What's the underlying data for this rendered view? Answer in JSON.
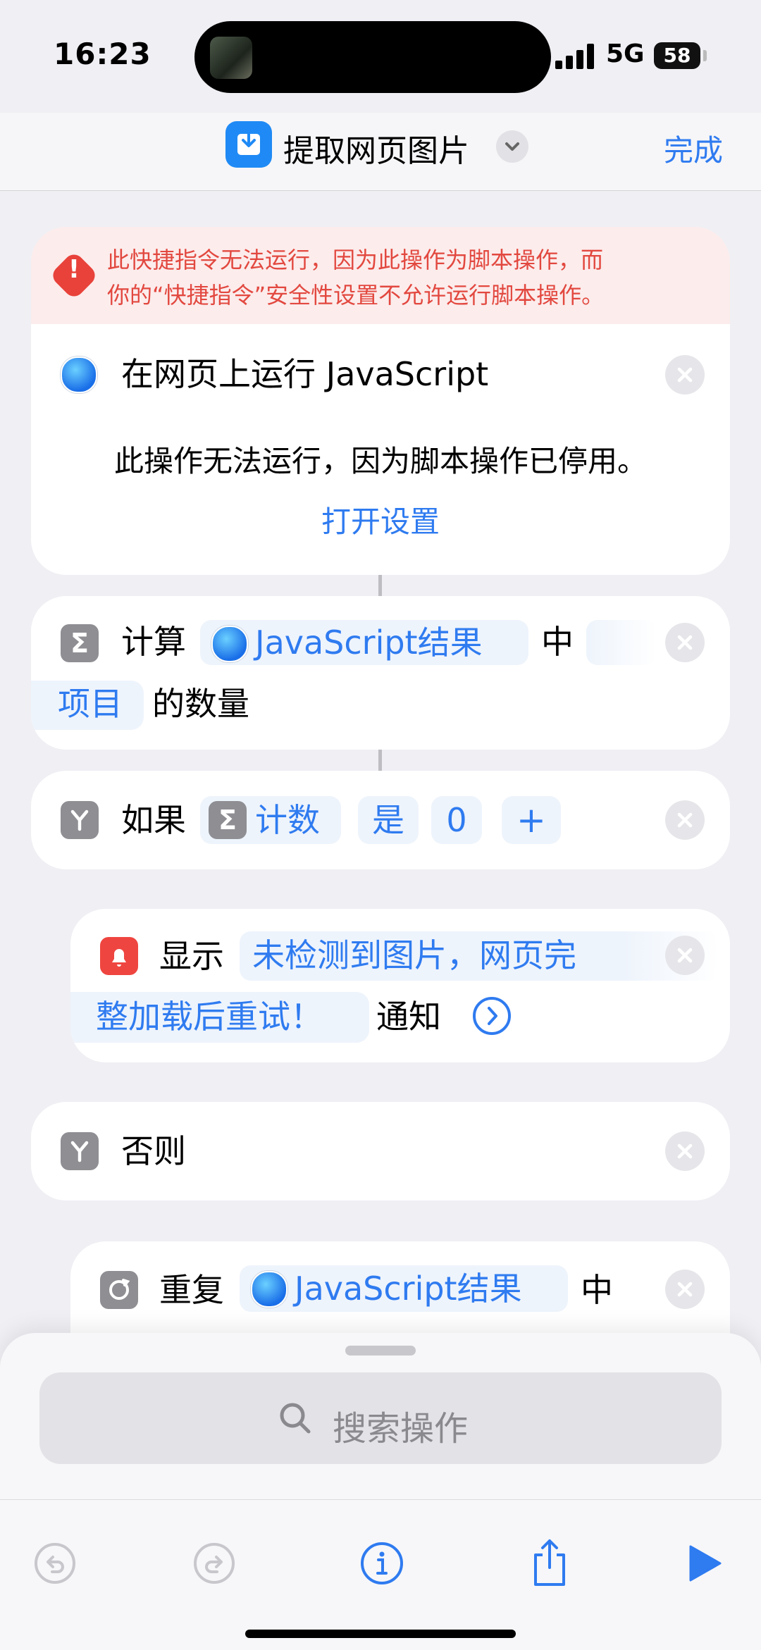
{
  "status": {
    "time": "16:23",
    "network": "5G",
    "battery": "58"
  },
  "nav": {
    "title": "提取网页图片",
    "done_label": "完成"
  },
  "error": {
    "line1": "此快捷指令无法运行，因为此操作为脚本操作，而",
    "line2": "你的“快捷指令”安全性设置不允许运行脚本操作。"
  },
  "js_action": {
    "title": "在网页上运行 JavaScript",
    "disabled_message": "此操作无法运行，因为脚本操作已停用。",
    "open_settings": "打开设置"
  },
  "count_action": {
    "verb": "计算",
    "input_token": "JavaScript结果",
    "in": "中",
    "item_token": "项目",
    "suffix": "的数量"
  },
  "if_action": {
    "verb": "如果",
    "var_token": "计数",
    "op_token": "是",
    "value_token": "0",
    "add_token": "+"
  },
  "notify_action": {
    "verb": "显示",
    "msg_line1": "未检测到图片，网页完",
    "msg_line2": "整加载后重试！",
    "suffix": "通知"
  },
  "else_action": {
    "label": "否则"
  },
  "repeat_action": {
    "verb": "重复",
    "input_token": "JavaScript结果",
    "in": "中"
  },
  "search": {
    "placeholder": "搜索操作"
  },
  "colors": {
    "accent": "#2f7bf0",
    "error": "#e2483f",
    "background": "#efeff4"
  }
}
